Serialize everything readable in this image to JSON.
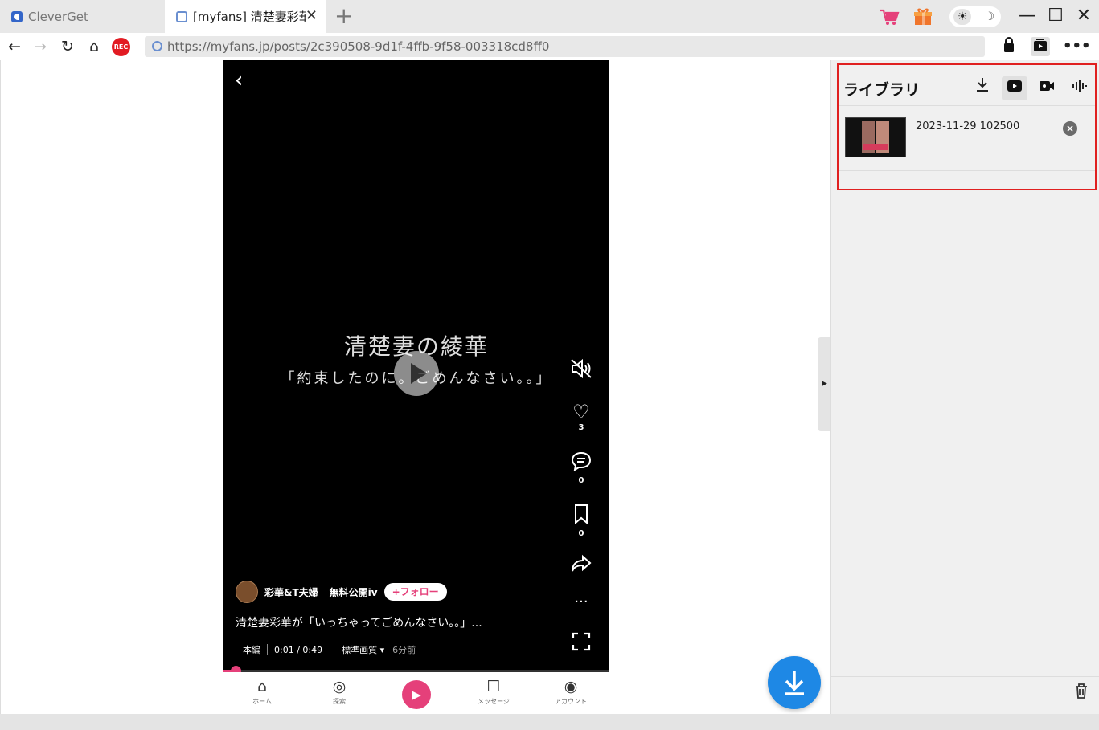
{
  "tabs": [
    {
      "title": "CleverGet",
      "active": false
    },
    {
      "title": "[myfans] 清楚妻彩華",
      "active": true
    }
  ],
  "window_controls": {
    "minimize": "—",
    "maximize": "☐",
    "close": "✕"
  },
  "theme": {
    "light_glyph": "☀",
    "dark_glyph": "☽"
  },
  "address_bar": {
    "url": "https://myfans.jp/posts/2c390508-9d1f-4ffb-9f58-003318cd8ff0",
    "rec_label": "REC"
  },
  "video": {
    "title_main": "清楚妻の綾華",
    "title_sub": "「約束したのに。ごめんなさい。。」",
    "likes": "3",
    "comments": "0",
    "bookmarks": "0",
    "author": "彩華&T夫婦",
    "free_label": "無料公開iv",
    "follow_label": "+フォロー",
    "caption": "清楚妻彩華が「いっちゃってごめんなさい。。」...",
    "mode": "本編",
    "time": "0:01 / 0:49",
    "quality": "標準画質",
    "posted": "6分前",
    "progress": 0.02
  },
  "bottom_nav": [
    {
      "label": "ホーム",
      "icon": "home-icon"
    },
    {
      "label": "探索",
      "icon": "compass-icon"
    },
    {
      "label": "メッセージ",
      "icon": "message-icon"
    },
    {
      "label": "アカウント",
      "icon": "account-icon"
    }
  ],
  "library": {
    "title": "ライブラリ",
    "items": [
      {
        "name": "2023-11-29 102500"
      }
    ]
  },
  "colors": {
    "accent": "#1e88e5",
    "brand_pink": "#e5407a",
    "highlight_border": "#e02020",
    "rec_red": "#e21b23"
  }
}
